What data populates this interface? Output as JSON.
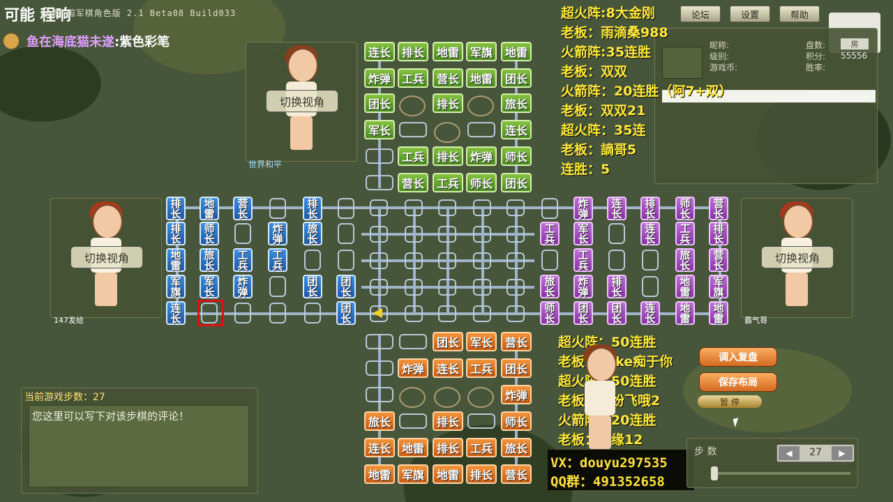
{
  "window": {
    "title": "可能 程响",
    "app_title": "QQ游 国军棋角色版 2.1 Beta08 Build033",
    "top_buttons": [
      "论坛",
      "设置",
      "帮助"
    ]
  },
  "current_user": {
    "name": "鱼在海底猫未遂",
    "suffix": ":紫色彩笔"
  },
  "players": {
    "top": {
      "switch_label": "切换视角",
      "name": "世界和平"
    },
    "left": {
      "switch_label": "切换视角",
      "name": "147发给"
    },
    "right": {
      "switch_label": "切换视角",
      "name": "霸气哥"
    }
  },
  "info_panel": {
    "labels": [
      "昵称:",
      "级别:",
      "游戏币:"
    ],
    "right_labels": [
      "盘数:",
      "积分:",
      "胜率:"
    ],
    "score": "55556",
    "room_tag": "房"
  },
  "overlay_top": [
    "超火阵:8大金刚",
    "老板：雨滴桑988",
    "火箭阵:35连胜",
    "老板：双双",
    "火箭阵：20连胜（阿7+双）",
    "老板：双双21",
    "超火阵：35连",
    "老板：謫哥5",
    "连胜：5"
  ],
  "overlay_bottom": [
    "超火阵：50连胜",
    "老板：Yoke痴于你",
    "超火阵：50连胜",
    "老板：我纷飞哦2",
    "火箭阵：20连胜",
    "老板：情缘12"
  ],
  "comment": {
    "header": "当前游戏步数：27",
    "placeholder": "您这里可以写下对该步棋的评论！"
  },
  "actions": {
    "load_replay": "调入复盘",
    "save_layout": "保存布局",
    "pause": "暂 停"
  },
  "ad": {
    "vx": "VX：douyu297535",
    "qq": "QQ群：491352658"
  },
  "steps": {
    "label": "步 数",
    "value": "27"
  },
  "board": {
    "green_rows": [
      [
        "连长",
        "排长",
        "地雷",
        "军旗",
        "地雷"
      ],
      [
        "炸弹",
        "工兵",
        "营长",
        "地雷",
        "团长"
      ],
      [
        "团长",
        "",
        "排长",
        "",
        "旅长"
      ],
      [
        "军长",
        "",
        "",
        "",
        "连长"
      ],
      [
        "",
        "工兵",
        "排长",
        "炸弹",
        "师长"
      ],
      [
        "",
        "营长",
        "工兵",
        "师长",
        "团长"
      ]
    ],
    "orange_rows": [
      [
        "",
        "",
        "团长",
        "军长",
        "营长"
      ],
      [
        "",
        "炸弹",
        "连长",
        "工兵",
        "团长"
      ],
      [
        "",
        "",
        "",
        "",
        "炸弹"
      ],
      [
        "旅长",
        "",
        "排长",
        "",
        "师长"
      ],
      [
        "连长",
        "地雷",
        "排长",
        "工兵",
        "旅长"
      ],
      [
        "地雷",
        "军旗",
        "地雷",
        "排长",
        "营长"
      ]
    ],
    "blue_cols": [
      [
        "排长",
        "排长",
        "地雷",
        "军旗",
        "连长"
      ],
      [
        "地雷",
        "师长",
        "旅长",
        "军长",
        ""
      ],
      [
        "营长",
        "",
        "工兵",
        "炸弹",
        ""
      ],
      [
        "",
        "炸弹",
        "工兵",
        "",
        ""
      ],
      [
        "排长",
        "旅长",
        "",
        "团长",
        ""
      ],
      [
        "",
        "",
        "",
        "团长",
        "团长"
      ]
    ],
    "purple_cols": [
      [
        "",
        "工兵",
        "",
        "旅长",
        "师长"
      ],
      [
        "炸弹",
        "军长",
        "工兵",
        "炸弹",
        "团长"
      ],
      [
        "连长",
        "",
        "",
        "排长",
        "团长"
      ],
      [
        "排长",
        "连长",
        "",
        "",
        "连长"
      ],
      [
        "师长",
        "工兵",
        "旅长",
        "地雷",
        "地雷"
      ],
      [
        "营长",
        "排长",
        "营长",
        "军旗",
        "地雷"
      ]
    ]
  }
}
